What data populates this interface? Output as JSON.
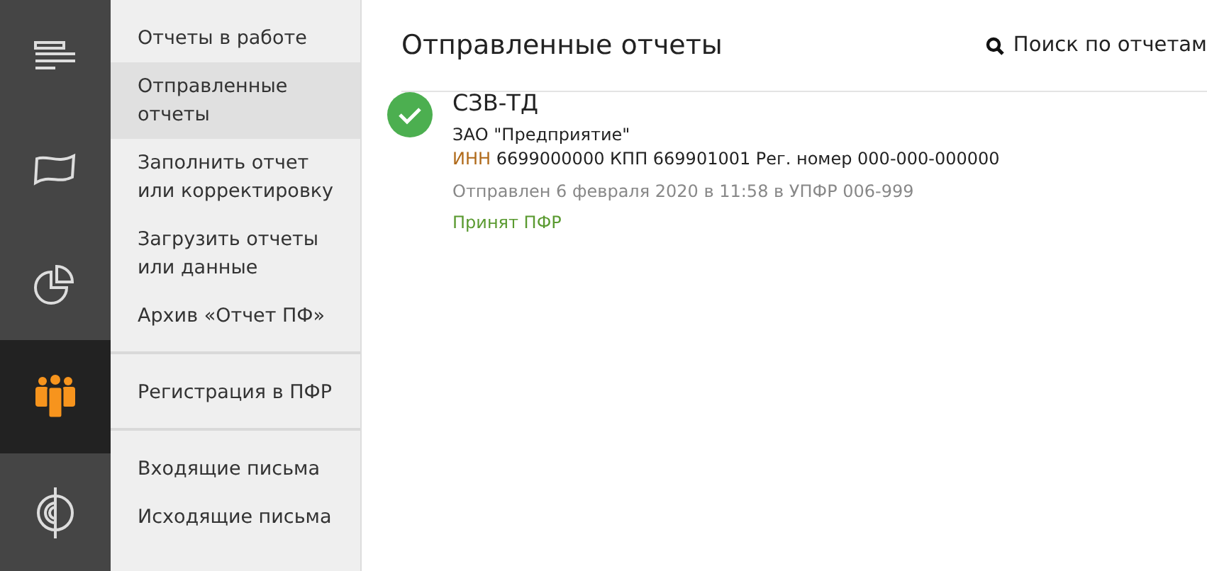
{
  "rail": [
    {
      "kind": "document",
      "selected": false
    },
    {
      "kind": "flag",
      "selected": false
    },
    {
      "kind": "pie",
      "selected": false
    },
    {
      "kind": "people",
      "selected": true
    },
    {
      "kind": "target",
      "selected": false
    }
  ],
  "menu_groups": [
    [
      {
        "label": "Отчеты в работе",
        "selected": false
      },
      {
        "label": "Отправленные отчеты",
        "selected": true
      },
      {
        "label": "Заполнить отчет или корректировку",
        "selected": false
      },
      {
        "label": "Загрузить отчеты или данные",
        "selected": false
      },
      {
        "label": "Архив «Отчет ПФ»",
        "selected": false
      }
    ],
    [
      {
        "label": "Регистрация в ПФР",
        "selected": false
      }
    ],
    [
      {
        "label": "Входящие письма",
        "selected": false
      },
      {
        "label": "Исходящие письма",
        "selected": false
      }
    ]
  ],
  "header": {
    "title": "Отправленные отчеты",
    "search": "Поиск по отчетам"
  },
  "reports": [
    {
      "name": "СЗВ-ТД",
      "company": "ЗАО \"Предприятие\"",
      "inn_label": "ИНН",
      "details": "6699000000 КПП 669901001 Рег. номер 000-000-000000",
      "sent": "Отправлен 6 февраля 2020 в 11:58 в УПФР 006-999",
      "status": "Принят ПФР",
      "accepted": true
    }
  ]
}
